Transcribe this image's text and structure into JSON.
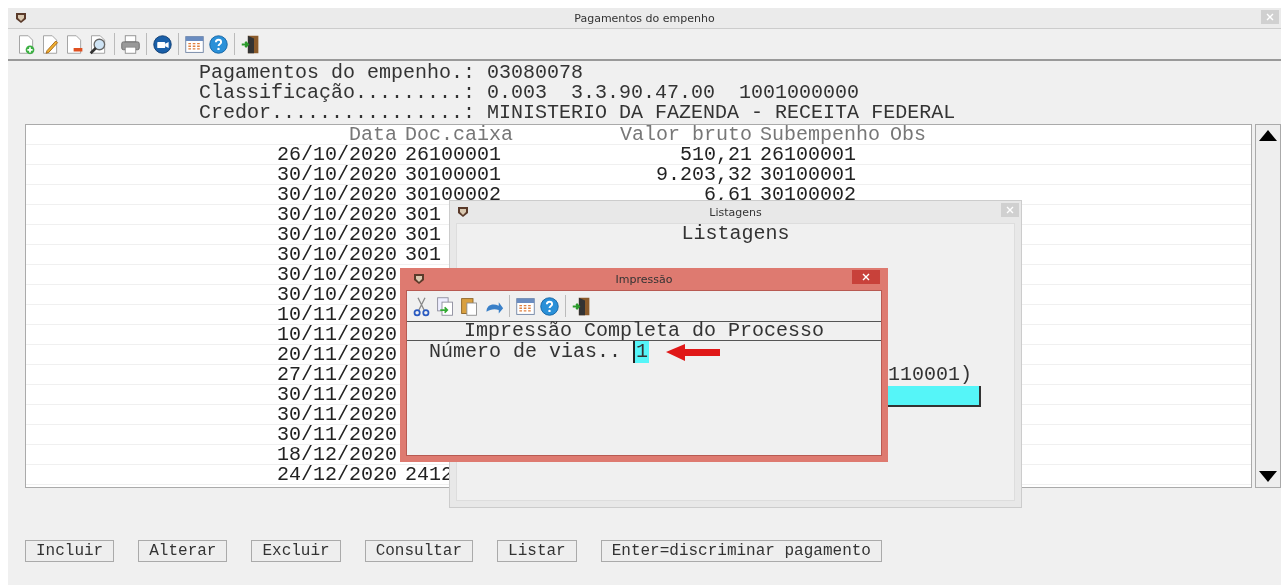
{
  "window": {
    "title": "Pagamentos do empenho"
  },
  "header": [
    {
      "label": "Pagamentos do empenho.:",
      "value": "03080078"
    },
    {
      "label": "Classificação.........:",
      "value": "0.003  3.3.90.47.00  1001000000"
    },
    {
      "label": "Credor................:",
      "value": "MINISTERIO DA FAZENDA - RECEITA FEDERAL"
    }
  ],
  "table": {
    "columns": [
      "Data",
      "Doc.caixa",
      "Valor bruto",
      "Subempenho",
      "Obs"
    ],
    "rows": [
      {
        "data": "26/10/2020",
        "doc_caixa": "26100001",
        "valor_bruto": "510,21",
        "subempenho": "26100001"
      },
      {
        "data": "30/10/2020",
        "doc_caixa": "30100001",
        "valor_bruto": "9.203,32",
        "subempenho": "30100001"
      },
      {
        "data": "30/10/2020",
        "doc_caixa": "30100002",
        "valor_bruto": "6,61",
        "subempenho": "30100002"
      },
      {
        "data": "30/10/2020",
        "doc_caixa": "301"
      },
      {
        "data": "30/10/2020",
        "doc_caixa": "301"
      },
      {
        "data": "30/10/2020",
        "doc_caixa": "301"
      },
      {
        "data": "30/10/2020"
      },
      {
        "data": "30/10/2020"
      },
      {
        "data": "10/11/2020"
      },
      {
        "data": "10/11/2020"
      },
      {
        "data": "20/11/2020"
      },
      {
        "data": "27/11/2020"
      },
      {
        "data": "30/11/2020"
      },
      {
        "data": "30/11/2020"
      },
      {
        "data": "30/11/2020"
      },
      {
        "data": "18/12/2020"
      },
      {
        "data": "24/12/2020",
        "doc_caixa": "2412"
      }
    ]
  },
  "buttons": [
    "Incluir",
    "Alterar",
    "Excluir",
    "Consultar",
    "Listar",
    "Enter=discriminar pagamento"
  ],
  "listagens": {
    "title": "Listagens",
    "heading": "Listagens",
    "text": "110001)"
  },
  "impressao": {
    "title": "Impressão",
    "heading": "Impressão Completa do Processo",
    "field_label": "Número de vias..",
    "field_value": "1"
  }
}
